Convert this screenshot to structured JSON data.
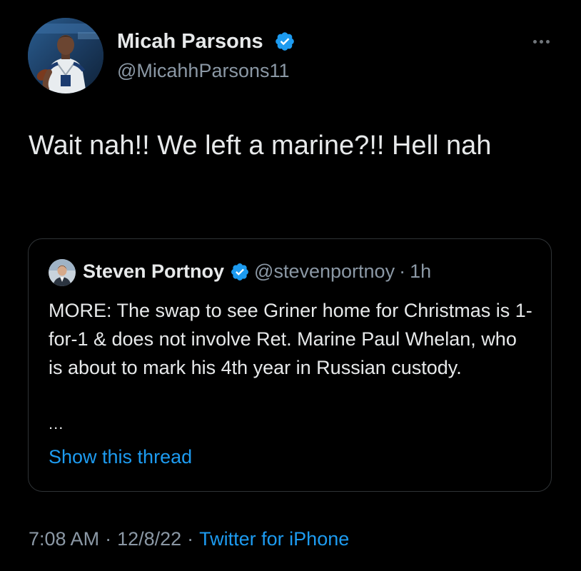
{
  "tweet": {
    "author": {
      "name": "Micah Parsons",
      "handle": "@MicahhParsons11",
      "verified": true,
      "avatar_icon": "football-player-avatar"
    },
    "more_icon": "more-options-icon",
    "text": "Wait nah!! We left a marine?!! Hell nah",
    "time": "7:08 AM",
    "separator": "·",
    "date": "12/8/22",
    "source": "Twitter for iPhone"
  },
  "quote": {
    "author": {
      "name": "Steven Portnoy",
      "handle": "@stevenportnoy",
      "verified": true,
      "avatar_icon": "person-avatar"
    },
    "separator": "·",
    "time": "1h",
    "text": "MORE: The swap to see Griner home for Christmas is 1-for-1 & does not involve Ret. Marine Paul Whelan, who is about to mark his 4th year in Russian custody.",
    "ellipsis": "...",
    "show_thread": "Show this thread"
  },
  "colors": {
    "background": "#000000",
    "primary_text": "#e7e9ea",
    "secondary_text": "#8b98a5",
    "link": "#1d9bf0",
    "verified_badge": "#1d9bf0",
    "border": "#2f3336"
  }
}
